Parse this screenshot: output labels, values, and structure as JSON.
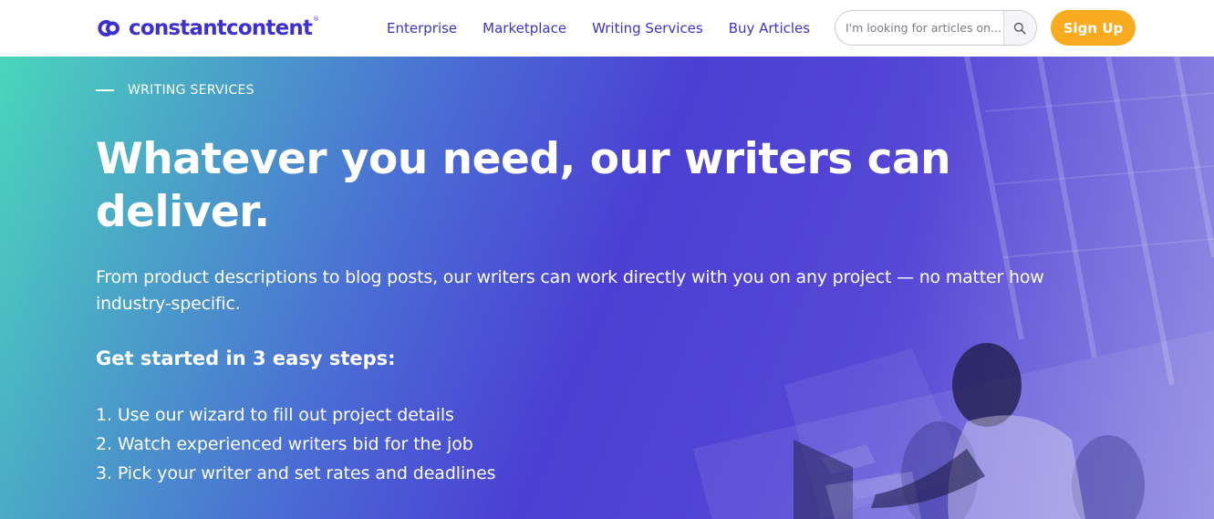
{
  "header": {
    "logo_text": "constantcontent",
    "logo_reg": "®",
    "nav": [
      {
        "label": "Enterprise"
      },
      {
        "label": "Marketplace"
      },
      {
        "label": "Writing Services"
      },
      {
        "label": "Buy Articles"
      }
    ],
    "search": {
      "placeholder": "I'm looking for articles on...",
      "icon": "search-icon"
    },
    "signup_label": "Sign Up"
  },
  "hero": {
    "eyebrow": "WRITING SERVICES",
    "headline": "Whatever you need, our writers can deliver.",
    "intro": "From product descriptions to blog posts, our writers can work directly with you on any project — no matter how industry-specific.",
    "steps_title": "Get started in 3 easy steps:",
    "steps": [
      "1. Use our wizard to fill out project details",
      "2. Watch experienced writers bid for the job",
      "3. Pick your writer and set rates and deadlines"
    ]
  },
  "colors": {
    "brand": "#3e2fcf",
    "nav_link": "#3d33c6",
    "signup": "#f9ab1f",
    "hero_gradient_start": "#49d6bb",
    "hero_gradient_mid": "#4b3fd3",
    "hero_gradient_end": "#7b74dc"
  }
}
